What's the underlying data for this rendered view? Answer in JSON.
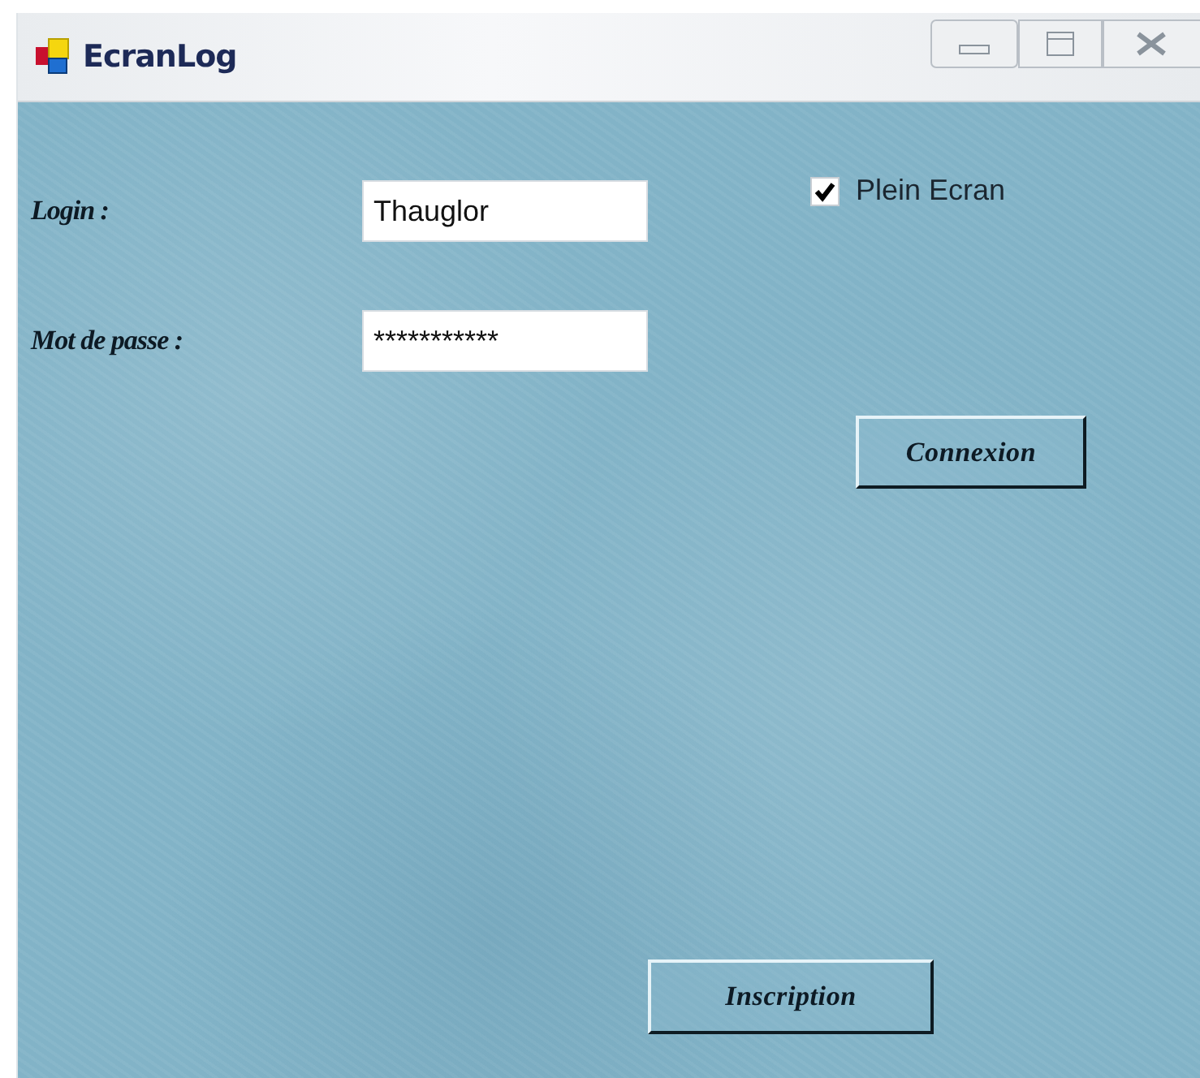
{
  "window": {
    "title": "EcranLog"
  },
  "form": {
    "login": {
      "label": "Login :",
      "value": "Thauglor"
    },
    "password": {
      "label": "Mot de passe :",
      "value": "***********"
    },
    "full_screen": {
      "label": "Plein Ecran",
      "checked": true
    }
  },
  "buttons": [
    {
      "label": "Connexion"
    },
    {
      "label": "Inscription"
    }
  ]
}
